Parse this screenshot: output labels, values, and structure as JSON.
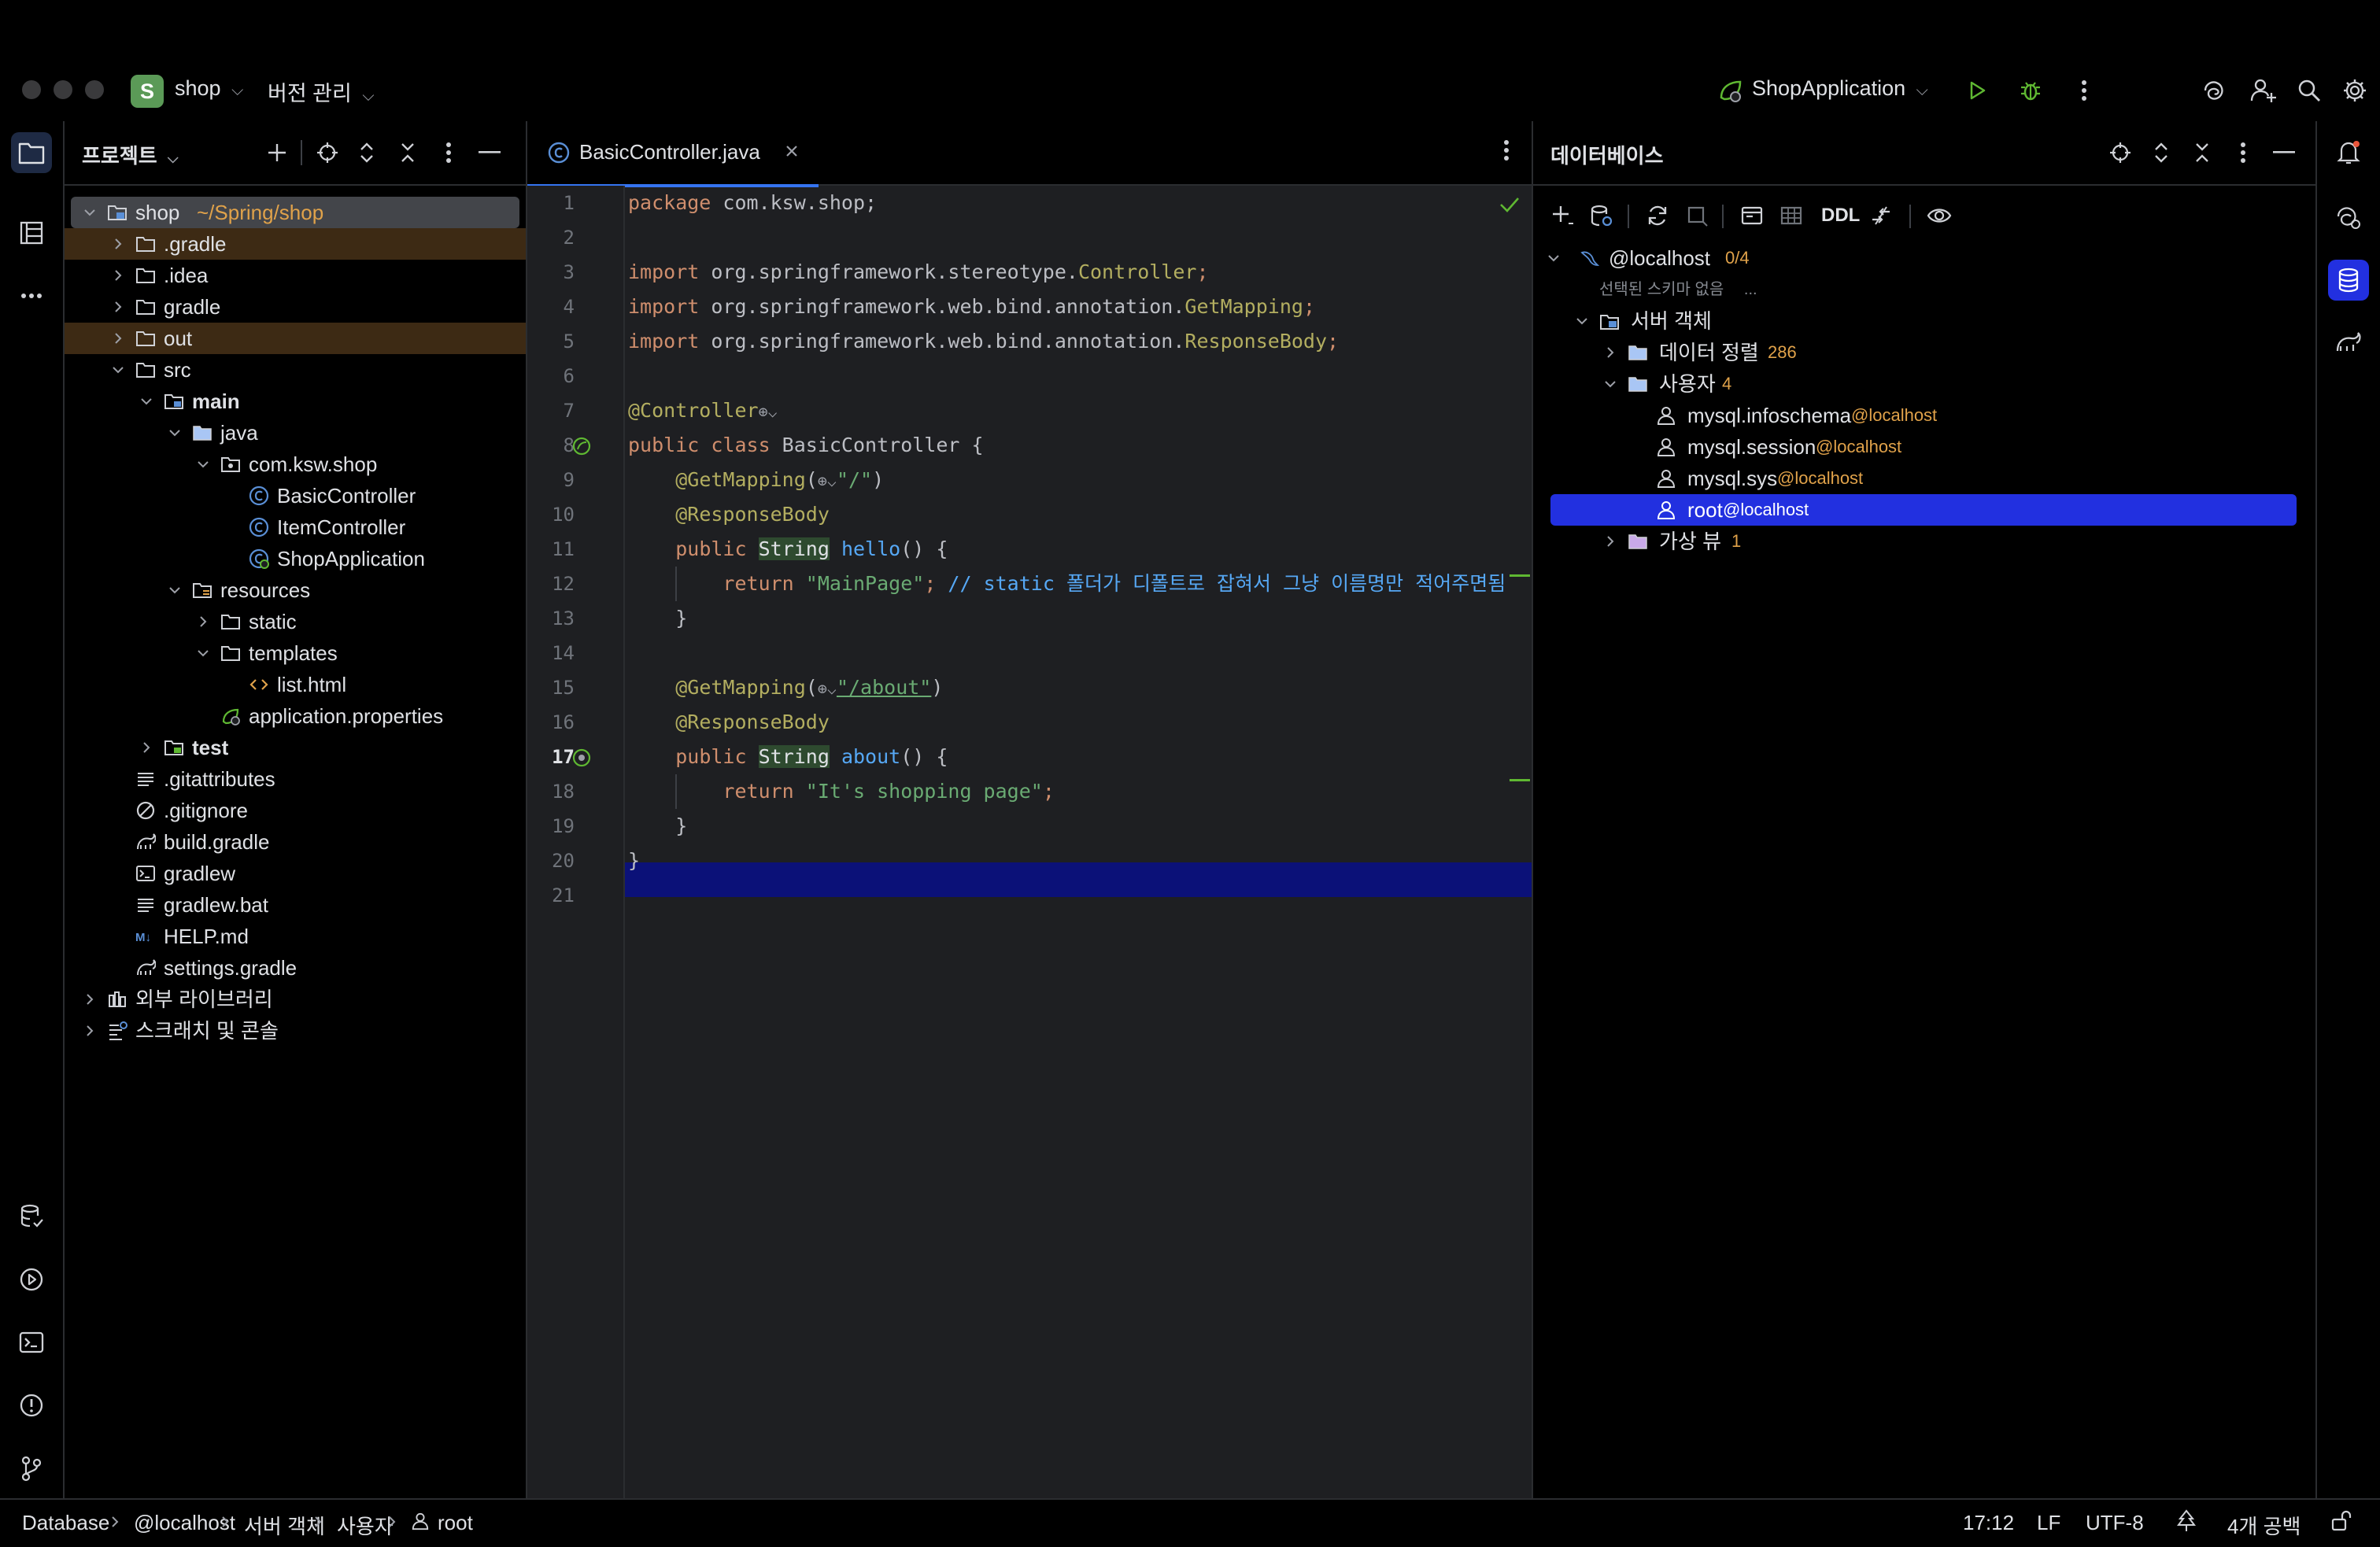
{
  "titlebar": {
    "project_badge": "S",
    "project_name": "shop",
    "vcs_menu": "버전 관리",
    "run_config": "ShopApplication"
  },
  "project_panel": {
    "title": "프로젝트",
    "tree": [
      {
        "label": "shop",
        "suffix": "~/Spring/shop",
        "icon": "module-folder-icon",
        "expanded": true
      },
      {
        "label": ".gradle",
        "icon": "folder-icon",
        "excluded": true
      },
      {
        "label": ".idea",
        "icon": "folder-icon"
      },
      {
        "label": "gradle",
        "icon": "folder-icon"
      },
      {
        "label": "out",
        "icon": "folder-icon",
        "excluded": true
      },
      {
        "label": "src",
        "icon": "folder-icon",
        "expanded": true
      },
      {
        "label": "main",
        "icon": "source-folder-icon",
        "expanded": true,
        "bold": true
      },
      {
        "label": "java",
        "icon": "java-source-folder-icon",
        "expanded": true
      },
      {
        "label": "com.ksw.shop",
        "icon": "package-icon",
        "expanded": true
      },
      {
        "label": "BasicController",
        "icon": "class-icon"
      },
      {
        "label": "ItemController",
        "icon": "class-icon"
      },
      {
        "label": "ShopApplication",
        "icon": "spring-class-icon"
      },
      {
        "label": "resources",
        "icon": "resources-folder-icon",
        "expanded": true
      },
      {
        "label": "static",
        "icon": "folder-icon"
      },
      {
        "label": "templates",
        "icon": "folder-icon",
        "expanded": true
      },
      {
        "label": "list.html",
        "icon": "html-icon"
      },
      {
        "label": "application.properties",
        "icon": "spring-properties-icon"
      },
      {
        "label": "test",
        "icon": "test-folder-icon",
        "bold": true
      },
      {
        "label": ".gitattributes",
        "icon": "text-file-icon"
      },
      {
        "label": ".gitignore",
        "icon": "ignore-file-icon"
      },
      {
        "label": "build.gradle",
        "icon": "gradle-icon"
      },
      {
        "label": "gradlew",
        "icon": "shell-script-icon"
      },
      {
        "label": "gradlew.bat",
        "icon": "text-file-icon"
      },
      {
        "label": "HELP.md",
        "icon": "markdown-icon"
      },
      {
        "label": "settings.gradle",
        "icon": "gradle-icon"
      },
      {
        "label": "외부 라이브러리",
        "icon": "library-icon"
      },
      {
        "label": "스크래치 및 콘솔",
        "icon": "scratch-icon"
      }
    ]
  },
  "editor": {
    "tab_label": "BasicController.java",
    "current_line": 17,
    "line_numbers": [
      "1",
      "2",
      "3",
      "4",
      "5",
      "6",
      "7",
      "8",
      "9",
      "10",
      "11",
      "12",
      "13",
      "14",
      "15",
      "16",
      "17",
      "18",
      "19",
      "20",
      "21"
    ],
    "code": {
      "l1_kw": "package",
      "l1_rest": " com.ksw.shop;",
      "l3_kw": "import",
      "l3_pkg": " org.springframework.stereotype.",
      "l3_cls": "Controller",
      "l3_end": ";",
      "l4_kw": "import",
      "l4_pkg": " org.springframework.web.bind.annotation.",
      "l4_cls": "GetMapping",
      "l4_end": ";",
      "l5_kw": "import",
      "l5_pkg": " org.springframework.web.bind.annotation.",
      "l5_cls": "ResponseBody",
      "l5_end": ";",
      "l7_ann": "@Controller",
      "l8_kw": "public class",
      "l8_name": " BasicController {",
      "l9_ann": "@GetMapping",
      "l9_open": "(",
      "l9_str": "\"/\"",
      "l9_close": ")",
      "l10_ann": "@ResponseBody",
      "l11_kw": "public",
      "l11_type": "String",
      "l11_fn": " hello",
      "l11_rest": "() {",
      "l12_kw": "return",
      "l12_str": " \"MainPage\"",
      "l12_semi": ";",
      "l12_cmt": " // static 폴더가 디폴트로 잡혀서 그냥 이름명만 적어주면됨",
      "l13": "}",
      "l15_ann": "@GetMapping",
      "l15_open": "(",
      "l15_str": "\"/about\"",
      "l15_close": ")",
      "l16_ann": "@ResponseBody",
      "l17_kw": "public",
      "l17_type": "String",
      "l17_fn": " about",
      "l17_rest": "() {",
      "l18_kw": "return",
      "l18_str": " \"It's shopping page\"",
      "l18_semi": ";",
      "l19": "}",
      "l20": "}"
    }
  },
  "database_panel": {
    "title": "데이터베이스",
    "toolbar_ddl": "DDL",
    "datasource": {
      "label": "@localhost",
      "count": "0/4"
    },
    "no_schema": "선택된 스키마 없음",
    "no_schema_more": "...",
    "server_objects": "서버 객체",
    "collations": {
      "label": "데이터 정렬",
      "count": "286"
    },
    "users": {
      "label": "사용자",
      "count": "4"
    },
    "user_items": [
      {
        "name": "mysql.infoschema",
        "host": "@localhost"
      },
      {
        "name": "mysql.session",
        "host": "@localhost"
      },
      {
        "name": "mysql.sys",
        "host": "@localhost"
      },
      {
        "name": "root",
        "host": "@localhost"
      }
    ],
    "virtual_views": {
      "label": "가상 뷰",
      "count": "1"
    }
  },
  "statusbar": {
    "breadcrumb": [
      "Database",
      "@localhost",
      "서버 객체",
      "사용자",
      "root"
    ],
    "position": "17:12",
    "line_sep": "LF",
    "encoding": "UTF-8",
    "indent": "4개 공백"
  },
  "colors": {
    "accent": "#3574f0",
    "selection_db": "#2230e0",
    "current_line": "#0b1178",
    "orange_count": "#e0a24a",
    "run_green": "#5fb832"
  }
}
